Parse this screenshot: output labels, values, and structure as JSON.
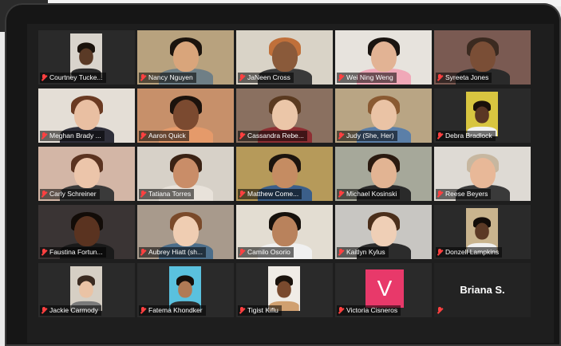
{
  "participants": [
    {
      "name": "Courtney Tucke...",
      "muted": true,
      "kind": "thumb",
      "room": "#2a2a2a",
      "thumb": "#d9d4cc",
      "skin": "#5a3a26",
      "hair": "#1a120c",
      "shirt": "#2b2b2b"
    },
    {
      "name": "Nancy Nguyen",
      "muted": true,
      "kind": "full",
      "room": "#b8a27e",
      "skin": "#d9a57b",
      "hair": "#1b130d",
      "shirt": "#6f7f86"
    },
    {
      "name": "JaNeen Cross",
      "muted": true,
      "kind": "full",
      "room": "#d9d3c7",
      "skin": "#8a5a3a",
      "hair": "#c0703a",
      "shirt": "#3a3a3a"
    },
    {
      "name": "Wei Ning Weng",
      "muted": true,
      "kind": "full",
      "room": "#e7e3dd",
      "skin": "#e2b394",
      "hair": "#1a1410",
      "shirt": "#f0a8b8"
    },
    {
      "name": "Syreeta Jones",
      "muted": true,
      "kind": "full",
      "room": "#7a5a52",
      "skin": "#7a4e36",
      "hair": "#3b2a20",
      "shirt": "#2a2a2a"
    },
    {
      "name": "Meghan Brady ...",
      "muted": true,
      "kind": "full",
      "room": "#e4ded6",
      "skin": "#e9bfa2",
      "hair": "#6a3a22",
      "shirt": "#2f2f3a"
    },
    {
      "name": "Aaron Quick",
      "muted": true,
      "kind": "full",
      "room": "#c7906a",
      "skin": "#7b4a30",
      "hair": "#1b120c",
      "shirt": "#e59a6a"
    },
    {
      "name": "Cassandra Rebe...",
      "muted": true,
      "kind": "full",
      "room": "#8a7060",
      "skin": "#ebc6a8",
      "hair": "#5a3a20",
      "shirt": "#8e2f33"
    },
    {
      "name": "Judy (She, Her)",
      "muted": true,
      "kind": "full",
      "room": "#b9a584",
      "skin": "#eac3a5",
      "hair": "#8a5a32",
      "shirt": "#5b7fa8"
    },
    {
      "name": "Debra Bradlock",
      "muted": true,
      "kind": "thumb",
      "room": "#2a2a2a",
      "thumb": "#d8c540",
      "skin": "#5a3624",
      "hair": "#1a100a",
      "shirt": "#f2f2f2"
    },
    {
      "name": "Carly Schreiner",
      "muted": true,
      "kind": "full",
      "room": "#d3b6a6",
      "skin": "#ecc5aa",
      "hair": "#5a3320",
      "shirt": "#3a3a3a"
    },
    {
      "name": "Tatiana Torres",
      "muted": true,
      "kind": "full",
      "room": "#d7d1c8",
      "skin": "#c98d68",
      "hair": "#3a2214",
      "shirt": "#e8e2da"
    },
    {
      "name": "Matthew Come...",
      "muted": true,
      "kind": "full",
      "room": "#b69a5a",
      "skin": "#c58c62",
      "hair": "#1c140e",
      "shirt": "#3b5f8a"
    },
    {
      "name": "Michael Kosinski",
      "muted": true,
      "kind": "full",
      "room": "#a6a89a",
      "skin": "#e2b493",
      "hair": "#2a1a10",
      "shirt": "#2a2a2a"
    },
    {
      "name": "Reese Beyers",
      "muted": true,
      "kind": "full",
      "room": "#dedad4",
      "skin": "#e8b898",
      "hair": "#c7b7a0",
      "shirt": "#3a3a3a"
    },
    {
      "name": "Faustina Fortun...",
      "muted": true,
      "kind": "full",
      "room": "#3a3434",
      "skin": "#5a3320",
      "hair": "#120c08",
      "shirt": "#1a1a1a"
    },
    {
      "name": "Aubrey Hiatt (sh...",
      "muted": true,
      "kind": "full",
      "room": "#a89a8c",
      "skin": "#efcdb2",
      "hair": "#7a4a2a",
      "shirt": "#4c6e8a"
    },
    {
      "name": "Camilo Osorio",
      "muted": true,
      "kind": "full",
      "room": "#e3ddd2",
      "skin": "#b9825c",
      "hair": "#15100c",
      "shirt": "#f0f0f0"
    },
    {
      "name": "Kaitlyn Kylus",
      "muted": true,
      "kind": "full",
      "room": "#c8c6c2",
      "skin": "#efcfb6",
      "hair": "#4a2e1a",
      "shirt": "#2c2c2c"
    },
    {
      "name": "Donzell Lampkins",
      "muted": true,
      "kind": "thumb",
      "room": "#2a2a2a",
      "thumb": "#c9b48e",
      "skin": "#5b3925",
      "hair": "#120c08",
      "shirt": "#f0f0f0"
    },
    {
      "name": "Jackie Carmody",
      "muted": true,
      "kind": "thumb",
      "room": "#2a2a2a",
      "thumb": "#d6cfc4",
      "skin": "#eac3a5",
      "hair": "#3a2a20",
      "shirt": "#7a7a7a"
    },
    {
      "name": "Fatema Khondker",
      "muted": true,
      "kind": "thumb",
      "room": "#2a2a2a",
      "thumb": "#5ac1de",
      "skin": "#b07a55",
      "hair": "#15100c",
      "shirt": "#2c2c2c"
    },
    {
      "name": "Tigist Kiflu",
      "muted": true,
      "kind": "thumb",
      "room": "#2a2a2a",
      "thumb": "#f0ece6",
      "skin": "#7a4a2e",
      "hair": "#1a120c",
      "shirt": "#d0a070"
    },
    {
      "name": "Victoria Cisneros",
      "muted": true,
      "kind": "avatar",
      "room": "#2a2a2a",
      "letter": "V"
    },
    {
      "name": "Briana S.",
      "muted": true,
      "kind": "nameonly",
      "room": "#232323"
    }
  ],
  "colors": {
    "mute": "#ff4040",
    "avatar_bg": "#e8396a",
    "tile_bg": "#232323"
  }
}
